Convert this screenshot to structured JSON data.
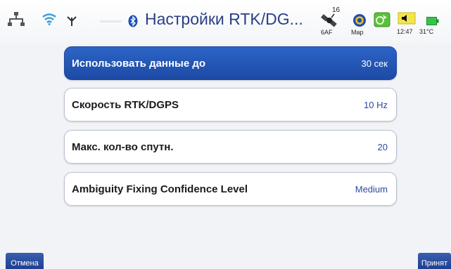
{
  "header": {
    "title": "Настройки RTK/DG...",
    "satellite_count": "16",
    "satellite_label": "6AF",
    "map_label": "Map",
    "time": "12:47",
    "temperature": "31°C",
    "icons": [
      "network-icon",
      "wifi-icon",
      "antenna-icon",
      "bluetooth-icon",
      "satellite-icon",
      "map-icon",
      "gps-icon",
      "volume-icon",
      "battery-icon"
    ]
  },
  "settings": [
    {
      "label": "Использовать данные до",
      "value": "30 сек"
    },
    {
      "label": "Скорость RTK/DGPS",
      "value": "10 Hz"
    },
    {
      "label": "Макс. кол-во спутн.",
      "value": "20"
    },
    {
      "label": "Ambiguity Fixing Confidence Level",
      "value": "Medium"
    }
  ],
  "footer": {
    "cancel_label": "Отмена",
    "accept_label": "Принят"
  },
  "colors": {
    "selected_row": "#2159b8",
    "value_text": "#2d4aa0",
    "softkey": "#2a4d9f"
  }
}
